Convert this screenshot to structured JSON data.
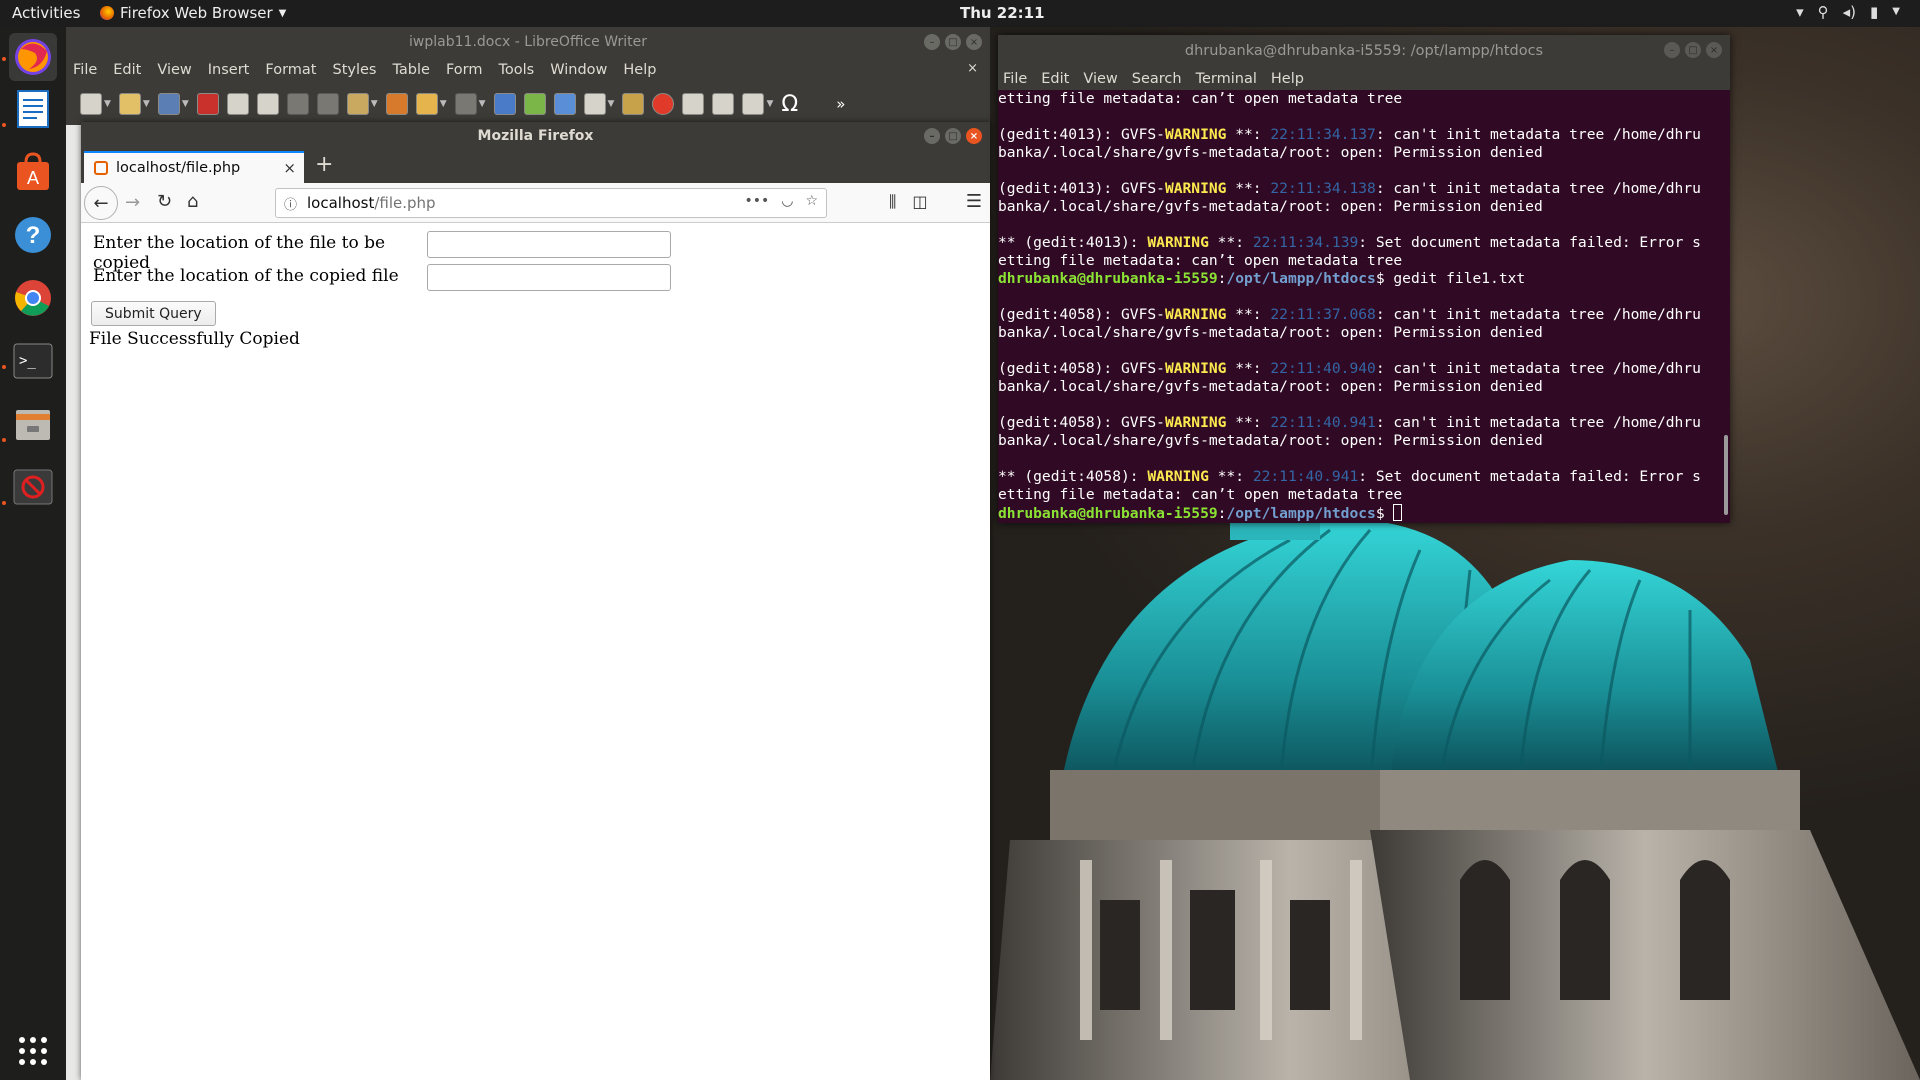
{
  "topbar": {
    "activities": "Activities",
    "app_name": "Firefox Web Browser",
    "clock": "Thu 22:11"
  },
  "dock": {
    "items": [
      "firefox-icon",
      "writer-icon",
      "software-center-icon",
      "help-icon",
      "chrome-icon",
      "terminal-icon",
      "files-icon",
      "blocked-app-icon",
      "app-grid-icon"
    ]
  },
  "writer": {
    "title": "iwplab11.docx - LibreOffice Writer",
    "menu": [
      "File",
      "Edit",
      "View",
      "Insert",
      "Format",
      "Styles",
      "Table",
      "Form",
      "Tools",
      "Window",
      "Help"
    ],
    "doc_close": "×",
    "more_tools": "»"
  },
  "firefox": {
    "title": "Mozilla Firefox",
    "tab_label": "localhost/file.php",
    "tab_close": "×",
    "new_tab": "+",
    "url_host": "localhost",
    "url_path": "/file.php",
    "url_more": "•••",
    "form": {
      "source_label": "Enter the location of the file to be copied",
      "source_value": "",
      "dest_label": "Enter the location of the copied file",
      "dest_value": "",
      "submit_label": "Submit Query",
      "result": "File Successfully Copied"
    }
  },
  "terminal": {
    "title": "dhrubanka@dhrubanka-i5559: /opt/lampp/htdocs",
    "menu": [
      "File",
      "Edit",
      "View",
      "Search",
      "Terminal",
      "Help"
    ],
    "lines": [
      [
        {
          "t": "etting file metadata: can’t open metadata tree",
          "c": ""
        }
      ],
      [
        {
          "t": "",
          "c": ""
        }
      ],
      [
        {
          "t": "(gedit:4013): GVFS-",
          "c": ""
        },
        {
          "t": "WARNING",
          "c": "t-warn"
        },
        {
          "t": " **: ",
          "c": ""
        },
        {
          "t": "22:11:34.137",
          "c": "t-time"
        },
        {
          "t": ": can't init metadata tree /home/dhru",
          "c": ""
        }
      ],
      [
        {
          "t": "banka/.local/share/gvfs-metadata/root: open: Permission denied",
          "c": ""
        }
      ],
      [
        {
          "t": "",
          "c": ""
        }
      ],
      [
        {
          "t": "(gedit:4013): GVFS-",
          "c": ""
        },
        {
          "t": "WARNING",
          "c": "t-warn"
        },
        {
          "t": " **: ",
          "c": ""
        },
        {
          "t": "22:11:34.138",
          "c": "t-time"
        },
        {
          "t": ": can't init metadata tree /home/dhru",
          "c": ""
        }
      ],
      [
        {
          "t": "banka/.local/share/gvfs-metadata/root: open: Permission denied",
          "c": ""
        }
      ],
      [
        {
          "t": "",
          "c": ""
        }
      ],
      [
        {
          "t": "** (gedit:4013): ",
          "c": ""
        },
        {
          "t": "WARNING",
          "c": "t-warn"
        },
        {
          "t": " **: ",
          "c": ""
        },
        {
          "t": "22:11:34.139",
          "c": "t-time"
        },
        {
          "t": ": Set document metadata failed: Error s",
          "c": ""
        }
      ],
      [
        {
          "t": "etting file metadata: can’t open metadata tree",
          "c": ""
        }
      ],
      [
        {
          "t": "dhrubanka@dhrubanka-i5559",
          "c": "t-user"
        },
        {
          "t": ":",
          "c": ""
        },
        {
          "t": "/opt/lampp/htdocs",
          "c": "t-path"
        },
        {
          "t": "$ gedit file1.txt",
          "c": ""
        }
      ],
      [
        {
          "t": "",
          "c": ""
        }
      ],
      [
        {
          "t": "(gedit:4058): GVFS-",
          "c": ""
        },
        {
          "t": "WARNING",
          "c": "t-warn"
        },
        {
          "t": " **: ",
          "c": ""
        },
        {
          "t": "22:11:37.068",
          "c": "t-time"
        },
        {
          "t": ": can't init metadata tree /home/dhru",
          "c": ""
        }
      ],
      [
        {
          "t": "banka/.local/share/gvfs-metadata/root: open: Permission denied",
          "c": ""
        }
      ],
      [
        {
          "t": "",
          "c": ""
        }
      ],
      [
        {
          "t": "(gedit:4058): GVFS-",
          "c": ""
        },
        {
          "t": "WARNING",
          "c": "t-warn"
        },
        {
          "t": " **: ",
          "c": ""
        },
        {
          "t": "22:11:40.940",
          "c": "t-time"
        },
        {
          "t": ": can't init metadata tree /home/dhru",
          "c": ""
        }
      ],
      [
        {
          "t": "banka/.local/share/gvfs-metadata/root: open: Permission denied",
          "c": ""
        }
      ],
      [
        {
          "t": "",
          "c": ""
        }
      ],
      [
        {
          "t": "(gedit:4058): GVFS-",
          "c": ""
        },
        {
          "t": "WARNING",
          "c": "t-warn"
        },
        {
          "t": " **: ",
          "c": ""
        },
        {
          "t": "22:11:40.941",
          "c": "t-time"
        },
        {
          "t": ": can't init metadata tree /home/dhru",
          "c": ""
        }
      ],
      [
        {
          "t": "banka/.local/share/gvfs-metadata/root: open: Permission denied",
          "c": ""
        }
      ],
      [
        {
          "t": "",
          "c": ""
        }
      ],
      [
        {
          "t": "** (gedit:4058): ",
          "c": ""
        },
        {
          "t": "WARNING",
          "c": "t-warn"
        },
        {
          "t": " **: ",
          "c": ""
        },
        {
          "t": "22:11:40.941",
          "c": "t-time"
        },
        {
          "t": ": Set document metadata failed: Error s",
          "c": ""
        }
      ],
      [
        {
          "t": "etting file metadata: can’t open metadata tree",
          "c": ""
        }
      ],
      [
        {
          "t": "dhrubanka@dhrubanka-i5559",
          "c": "t-user"
        },
        {
          "t": ":",
          "c": ""
        },
        {
          "t": "/opt/lampp/htdocs",
          "c": "t-path"
        },
        {
          "t": "$ ",
          "c": ""
        }
      ]
    ]
  },
  "colors": {
    "ubuntu_orange": "#e95420",
    "terminal_bg": "#300a24",
    "warning": "#fce94f",
    "timestamp": "#3465a4",
    "prompt_user": "#8ae234",
    "prompt_path": "#729fcf"
  }
}
